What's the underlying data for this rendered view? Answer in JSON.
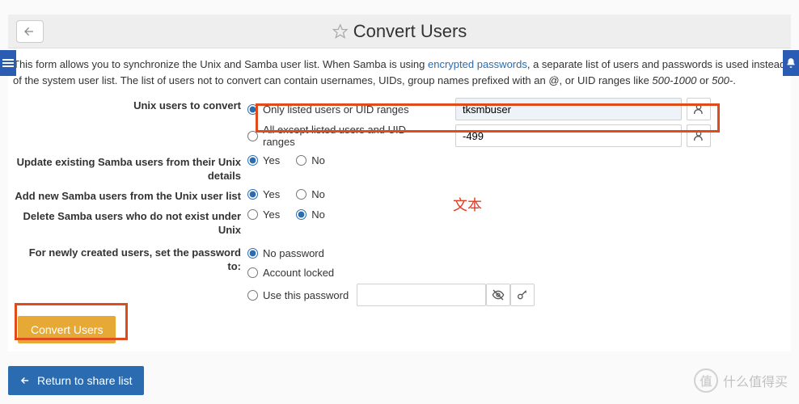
{
  "header": {
    "title": "Convert Users"
  },
  "desc": {
    "part1": "This form allows you to synchronize the Unix and Samba user list. When Samba is using ",
    "link": "encrypted passwords",
    "part2": ", a separate list of users and passwords is used instead of the system user list. The list of users not to convert can contain usernames, UIDs, group names prefixed with an @, or UID ranges like ",
    "range1": "500-1000",
    "or": " or ",
    "range2": "500-",
    "dot": "."
  },
  "form": {
    "unix_label": "Unix users to convert",
    "opt_listed": "Only listed users or UID ranges",
    "opt_except": "All except listed users and UID ranges",
    "val_listed": "tksmbuser",
    "val_except": "-499",
    "update_label": "Update existing Samba users from their Unix details",
    "add_label": "Add new Samba users from the Unix user list",
    "delete_label": "Delete Samba users who do not exist under Unix",
    "pw_label": "For newly created users, set the password to:",
    "yes": "Yes",
    "no": "No",
    "nopw": "No password",
    "locked": "Account locked",
    "usepw": "Use this password"
  },
  "buttons": {
    "convert": "Convert Users",
    "return": "Return to share list"
  },
  "annotation": "文本",
  "watermark": "什么值得买"
}
